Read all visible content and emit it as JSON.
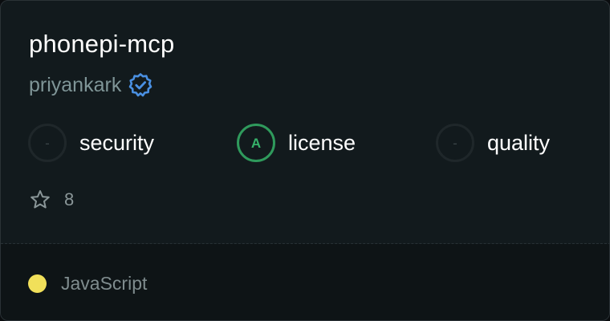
{
  "repo": {
    "name": "phonepi-mcp",
    "owner": "priyankark",
    "verified_icon": "verified-badge-icon"
  },
  "metrics": [
    {
      "label": "security",
      "grade": "-"
    },
    {
      "label": "license",
      "grade": "A"
    },
    {
      "label": "quality",
      "grade": "-"
    }
  ],
  "stars": {
    "icon": "star-outline-icon",
    "count": "8"
  },
  "language": {
    "name": "JavaScript",
    "color": "#f1e05a"
  },
  "colors": {
    "verified": "#4a90e2",
    "grade_a": "#36b26a"
  }
}
